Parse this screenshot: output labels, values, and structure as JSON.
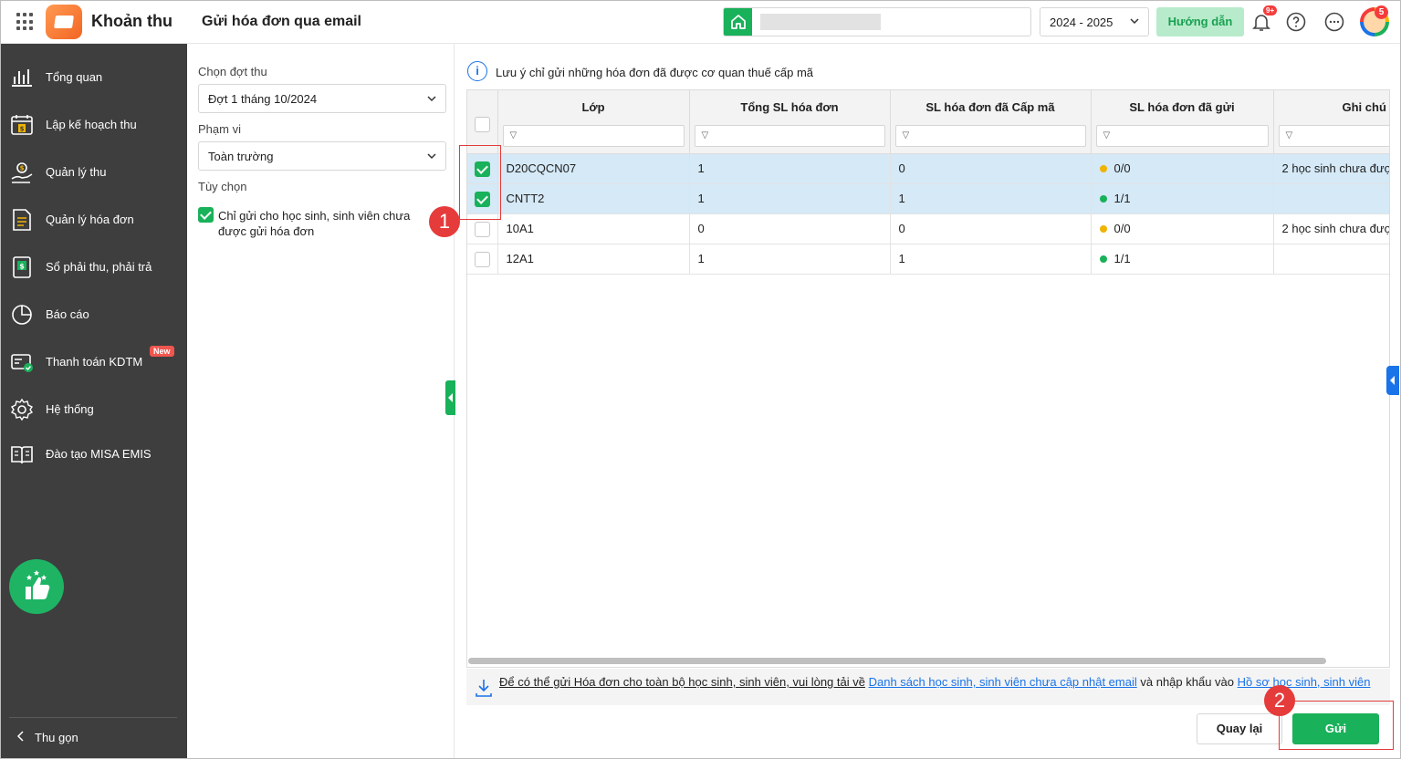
{
  "app": {
    "name": "Khoản thu",
    "page_title": "Gửi hóa đơn qua email"
  },
  "header": {
    "year_select": "2024 - 2025",
    "guide_label": "Hướng dẫn",
    "notifications_badge": "9+",
    "avatar_badge": "5"
  },
  "sidebar": {
    "items": [
      {
        "label": "Tổng quan",
        "icon": "dashboard-icon"
      },
      {
        "label": "Lập kế hoạch thu",
        "icon": "calendar-money-icon"
      },
      {
        "label": "Quản lý thu",
        "icon": "hand-money-icon"
      },
      {
        "label": "Quản lý hóa đơn",
        "icon": "invoice-icon"
      },
      {
        "label": "Sổ phải thu, phải trả",
        "icon": "ledger-icon"
      },
      {
        "label": "Báo cáo",
        "icon": "pie-chart-icon"
      },
      {
        "label": "Thanh toán KDTM",
        "icon": "payment-icon",
        "badge": "New"
      },
      {
        "label": "Hệ thống",
        "icon": "gear-icon"
      },
      {
        "label": "Đào tạo MISA EMIS",
        "icon": "book-icon"
      }
    ],
    "collapse_label": "Thu gọn"
  },
  "filters": {
    "period_label": "Chọn đợt thu",
    "period_value": "Đợt 1 tháng 10/2024",
    "scope_label": "Phạm vi",
    "scope_value": "Toàn trường",
    "options_label": "Tùy chọn",
    "option_text": "Chỉ gửi cho học sinh, sinh viên chưa được gửi hóa đơn",
    "option_checked": true
  },
  "notice": "Lưu ý chỉ gửi những hóa đơn đã được cơ quan thuế cấp mã",
  "table": {
    "columns": [
      "Lớp",
      "Tổng SL hóa đơn",
      "SL hóa đơn đã Cấp mã",
      "SL hóa đơn đã gửi",
      "Ghi chú"
    ],
    "rows": [
      {
        "selected": true,
        "class": "D20CQCN07",
        "total": "1",
        "issued": "0",
        "sent": "0/0",
        "status_color": "#f0b400",
        "note": "2 học sinh chưa được"
      },
      {
        "selected": true,
        "class": "CNTT2",
        "total": "1",
        "issued": "1",
        "sent": "1/1",
        "status_color": "#19b15a",
        "note": ""
      },
      {
        "selected": false,
        "class": "10A1",
        "total": "0",
        "issued": "0",
        "sent": "0/0",
        "status_color": "#f0b400",
        "note": "2 học sinh chưa được"
      },
      {
        "selected": false,
        "class": "12A1",
        "total": "1",
        "issued": "1",
        "sent": "1/1",
        "status_color": "#19b15a",
        "note": ""
      }
    ]
  },
  "download_bar": {
    "text1": "Để có thể gửi Hóa đơn cho toàn bộ học sinh, sinh viên, vui lòng tải về",
    "link1": "Danh sách học sinh, sinh viên chưa cập nhật email",
    "text2": "và nhập khẩu vào",
    "link2": "Hồ sơ học sinh, sinh viên"
  },
  "buttons": {
    "back": "Quay lại",
    "send": "Gửi"
  },
  "annotations": {
    "step1": "1",
    "step2": "2"
  },
  "colors": {
    "accent": "#19b15a",
    "sidebar_bg": "#3e3e3e",
    "selected_row": "#d5e9f7",
    "annotation": "#e63b3b"
  }
}
